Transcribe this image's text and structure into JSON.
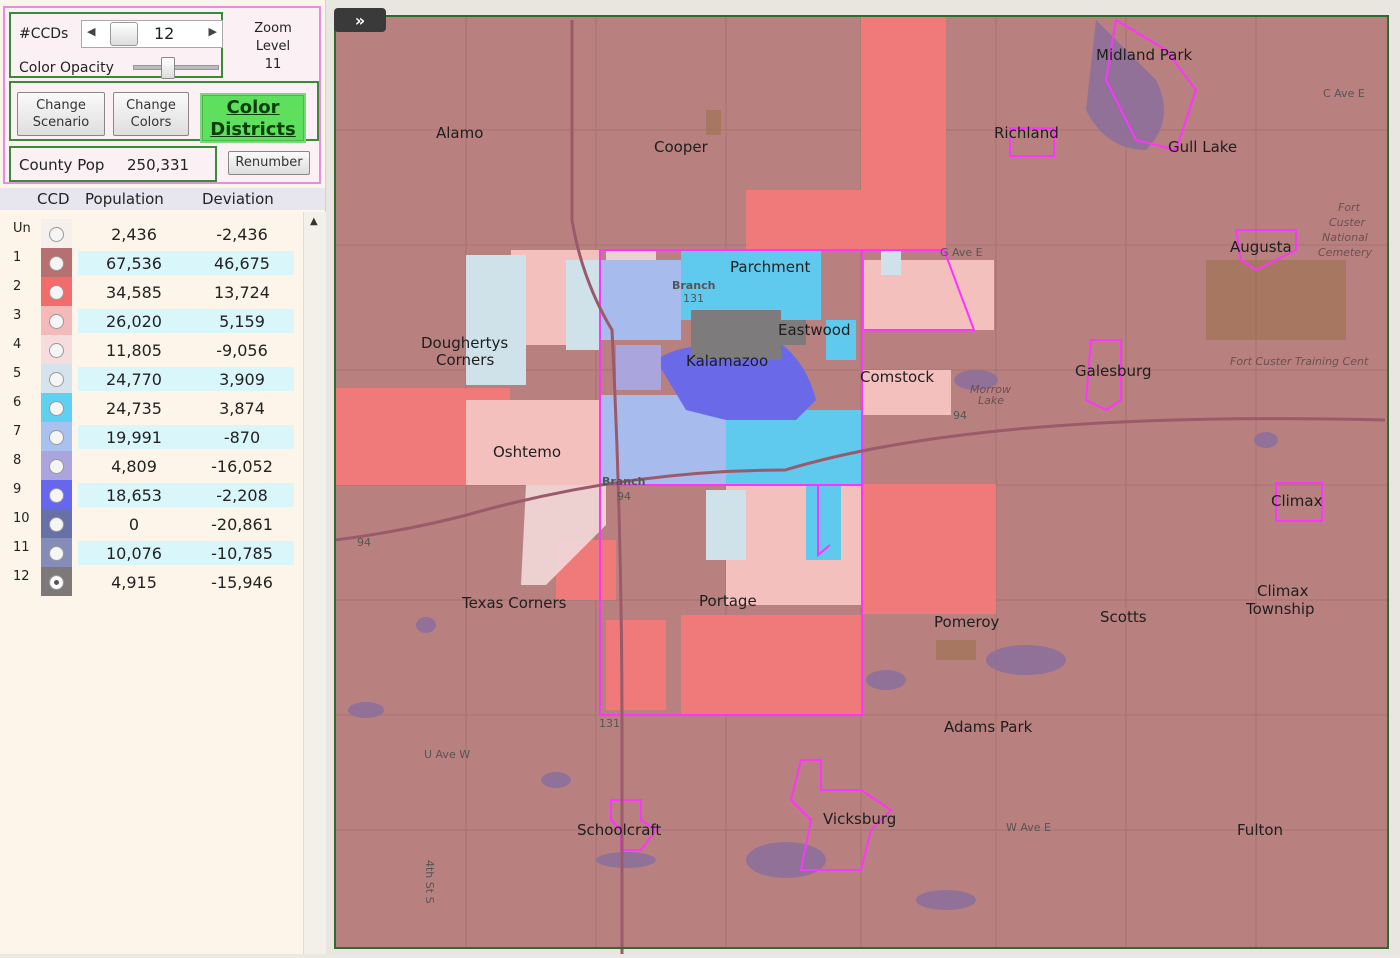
{
  "controls": {
    "ccds_label": "#CCDs",
    "ccds_value": "12",
    "opacity_label": "Color Opacity",
    "opacity_level": 0.4,
    "zoom_label_1": "Zoom",
    "zoom_label_2": "Level",
    "zoom_value": "11",
    "change_scenario_1": "Change",
    "change_scenario_2": "Scenario",
    "change_colors_1": "Change",
    "change_colors_2": "Colors",
    "color_districts_1": "Color",
    "color_districts_2": "Districts",
    "county_pop_label": "County Pop",
    "county_pop_value": "250,331",
    "renumber": "Renumber",
    "expand": "»"
  },
  "table": {
    "col_ccd": "CCD",
    "col_population": "Population",
    "col_deviation": "Deviation",
    "rows": [
      {
        "ccd": "Un",
        "population": "2,436",
        "deviation": "-2,436",
        "color": "#f4f1ec",
        "band": false,
        "selected": false
      },
      {
        "ccd": "1",
        "population": "67,536",
        "deviation": "46,675",
        "color": "#b67070",
        "band": true,
        "selected": false
      },
      {
        "ccd": "2",
        "population": "34,585",
        "deviation": "13,724",
        "color": "#f36c6c",
        "band": false,
        "selected": false
      },
      {
        "ccd": "3",
        "population": "26,020",
        "deviation": "5,159",
        "color": "#f4b9b9",
        "band": true,
        "selected": false
      },
      {
        "ccd": "4",
        "population": "11,805",
        "deviation": "-9,056",
        "color": "#f6dcdc",
        "band": false,
        "selected": false
      },
      {
        "ccd": "5",
        "population": "24,770",
        "deviation": "3,909",
        "color": "#d5e4ec",
        "band": true,
        "selected": false
      },
      {
        "ccd": "6",
        "population": "24,735",
        "deviation": "3,874",
        "color": "#5ed0f0",
        "band": false,
        "selected": false
      },
      {
        "ccd": "7",
        "population": "19,991",
        "deviation": "-870",
        "color": "#a9c1ef",
        "band": true,
        "selected": false
      },
      {
        "ccd": "8",
        "population": "4,809",
        "deviation": "-16,052",
        "color": "#aaa5dd",
        "band": false,
        "selected": false
      },
      {
        "ccd": "9",
        "population": "18,653",
        "deviation": "-2,208",
        "color": "#6666ee",
        "band": true,
        "selected": false
      },
      {
        "ccd": "10",
        "population": "0",
        "deviation": "-20,861",
        "color": "#6870a8",
        "band": false,
        "selected": false
      },
      {
        "ccd": "11",
        "population": "10,076",
        "deviation": "-10,785",
        "color": "#868cb8",
        "band": true,
        "selected": false
      },
      {
        "ccd": "12",
        "population": "4,915",
        "deviation": "-15,946",
        "color": "#7d7979",
        "band": false,
        "selected": true
      }
    ]
  },
  "map": {
    "places": [
      "Alamo",
      "Cooper",
      "Richland",
      "Gull Lake",
      "Midland Park",
      "Augusta",
      "Parchment",
      "Eastwood",
      "Kalamazoo",
      "Comstock",
      "Galesburg",
      "Doughertys",
      "Corners",
      "Oshtemo",
      "Climax",
      "Texas Corners",
      "Portage",
      "Pomeroy",
      "Scotts",
      "Climax",
      "Township",
      "Adams Park",
      "Schoolcraft",
      "Vicksburg",
      "Fulton"
    ],
    "features": [
      "Fort",
      "Custer",
      "National",
      "Cemetery",
      "Fort Custer Training Cent",
      "Morrow",
      "Lake"
    ],
    "roads": [
      "C Ave E",
      "G Ave E",
      "U Ave W",
      "W Ave E",
      "4th St S",
      "Branch",
      "Branch",
      "131",
      "131",
      "94",
      "94",
      "94"
    ]
  }
}
